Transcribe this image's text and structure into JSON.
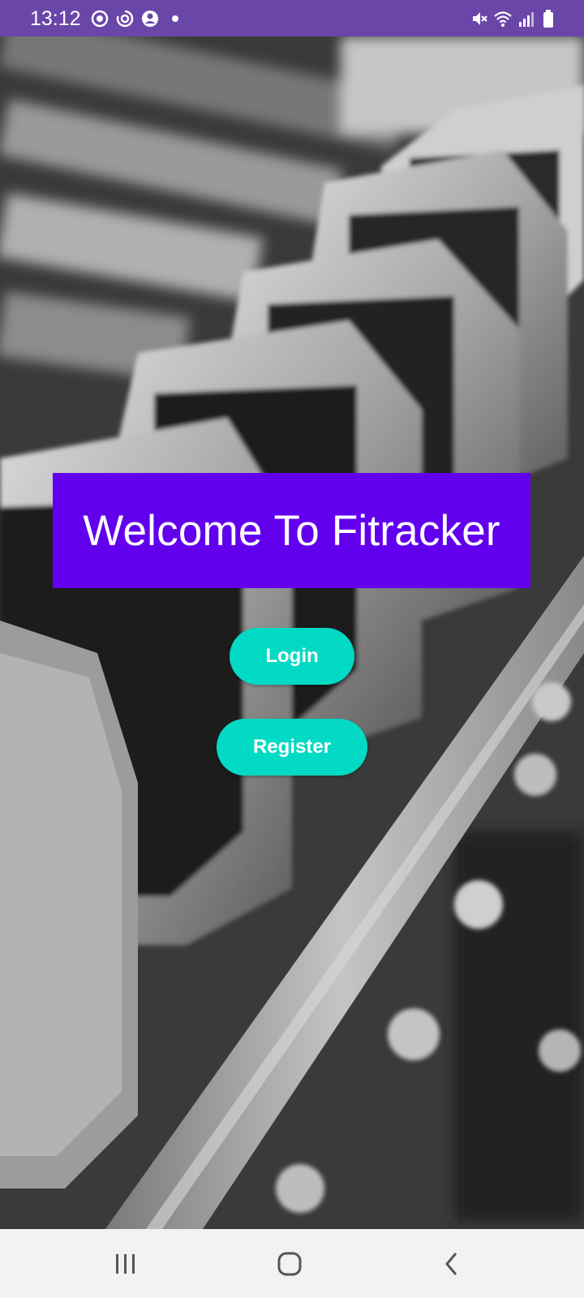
{
  "status_bar": {
    "time": "13:12",
    "background_color": "#6a46a8",
    "left_icons": [
      "sync-icon",
      "sync-alt-icon",
      "account-circle-icon",
      "notification-dot-icon"
    ],
    "right_icons": [
      "mute-icon",
      "wifi-icon",
      "signal-icon",
      "battery-icon"
    ]
  },
  "background": {
    "description_icon": "dumbbell-rack-photo"
  },
  "welcome": {
    "title": "Welcome To Fitracker",
    "background_color": "#6200ee"
  },
  "buttons": {
    "login_label": "Login",
    "register_label": "Register",
    "color": "#03dac5"
  },
  "nav_bar": {
    "icons": [
      "recents-icon",
      "home-icon",
      "back-icon"
    ]
  }
}
